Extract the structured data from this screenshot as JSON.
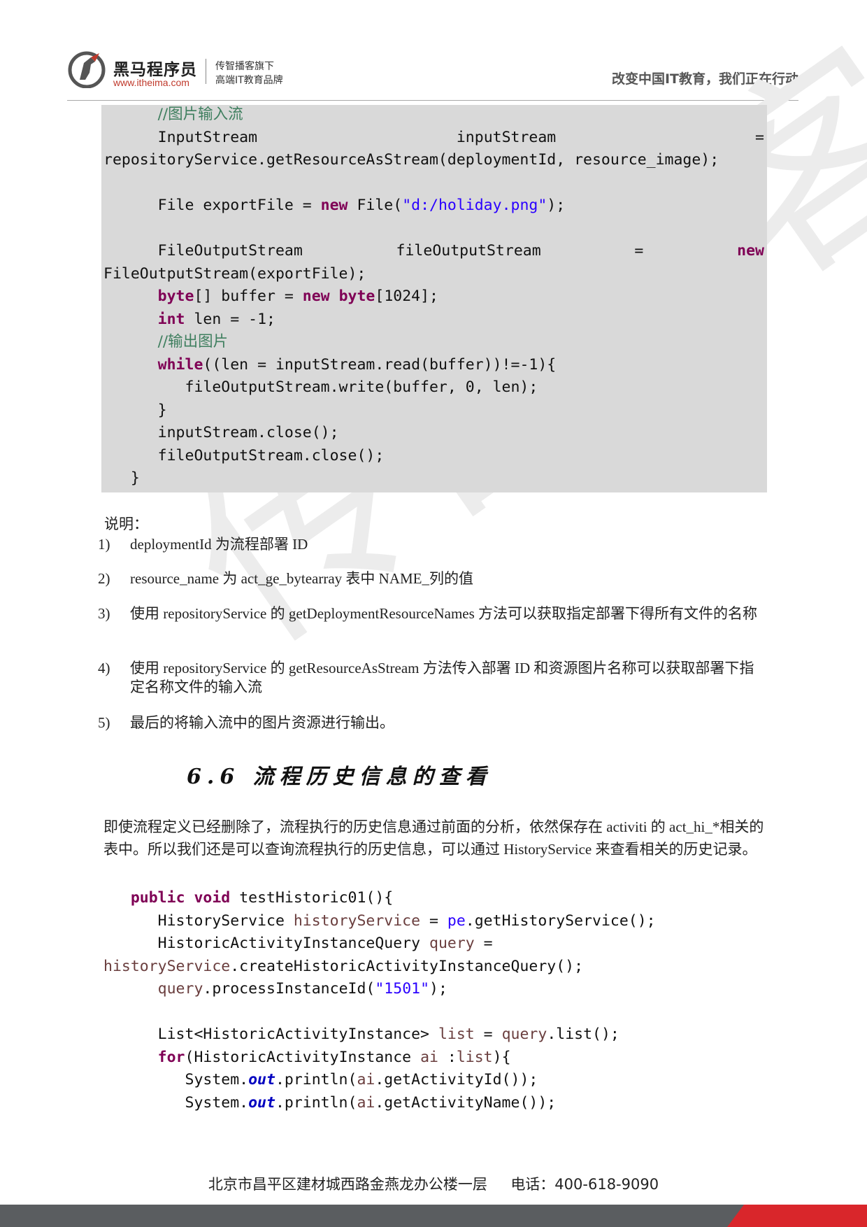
{
  "header": {
    "logo_cn": "黑马程序员",
    "logo_url": "www.itheima.com",
    "tagline_1": "传智播客旗下",
    "tagline_2": "高端IT教育品牌",
    "slogan": "改变中国IT教育，我们正在行动"
  },
  "watermark": "传智播客",
  "code1": {
    "l1": "//图片输入流",
    "l2a": "InputStream",
    "l2b": "inputStream",
    "l2c": "=",
    "l3": "repositoryService.getResourceAsStream(deploymentId, resource_image);",
    "l5a": "File exportFile = ",
    "l5b": "new",
    "l5c": " File(",
    "l5d": "\"d:/holiday.png\"",
    "l5e": ");",
    "l7a": "FileOutputStream",
    "l7b": "fileOutputStream",
    "l7c": "=",
    "l7d": "new",
    "l8": "FileOutputStream(exportFile);",
    "l9a": "byte",
    "l9b": "[] buffer = ",
    "l9c": "new",
    "l9d": " ",
    "l9e": "byte",
    "l9f": "[1024];",
    "l10a": "int",
    "l10b": " len = -1;",
    "l11": "//输出图片",
    "l12a": "while",
    "l12b": "((len = inputStream.read(buffer))!=-1){",
    "l13": "fileOutputStream.write(buffer, 0, len);",
    "l14": "}",
    "l15": "inputStream.close();",
    "l16": "fileOutputStream.close();",
    "l17": "}"
  },
  "notes": {
    "title": "说明：",
    "items": [
      {
        "num": "1)",
        "text": "deploymentId 为流程部署 ID"
      },
      {
        "num": "2)",
        "text": "resource_name 为 act_ge_bytearray 表中 NAME_列的值"
      },
      {
        "num": "3)",
        "text": "使用 repositoryService 的 getDeploymentResourceNames 方法可以获取指定部署下得所有文件的名称"
      },
      {
        "num": "4)",
        "text": "使用 repositoryService 的 getResourceAsStream 方法传入部署 ID 和资源图片名称可以获取部署下指定名称文件的输入流"
      },
      {
        "num": "5)",
        "text": "最后的将输入流中的图片资源进行输出。"
      }
    ]
  },
  "section": {
    "heading": "6.6 流程历史信息的查看",
    "intro": "即使流程定义已经删除了，流程执行的历史信息通过前面的分析，依然保存在 activiti 的 act_hi_*相关的表中。所以我们还是可以查询流程执行的历史信息，可以通过 HistoryService 来查看相关的历史记录。"
  },
  "code2": {
    "l1a": "public",
    "l1b": " ",
    "l1c": "void",
    "l1d": " testHistoric01(){",
    "l2a": "HistoryService ",
    "l2b": "historyService",
    "l2c": " = ",
    "l2d": "pe",
    "l2e": ".getHistoryService();",
    "l3a": "HistoricActivityInstanceQuery ",
    "l3b": "query",
    "l3c": " =",
    "l4a": "historyService",
    "l4b": ".createHistoricActivityInstanceQuery();",
    "l5a": "query",
    "l5b": ".processInstanceId(",
    "l5c": "\"1501\"",
    "l5d": ");",
    "l7a": "List<HistoricActivityInstance> ",
    "l7b": "list",
    "l7c": " = ",
    "l7d": "query",
    "l7e": ".list();",
    "l8a": "for",
    "l8b": "(HistoricActivityInstance ",
    "l8c": "ai",
    "l8d": " :",
    "l8e": "list",
    "l8f": "){",
    "l9a": "System.",
    "l9b": "out",
    "l9c": ".println(",
    "l9d": "ai",
    "l9e": ".getActivityId());",
    "l10a": "System.",
    "l10b": "out",
    "l10c": ".println(",
    "l10d": "ai",
    "l10e": ".getActivityName());"
  },
  "footer": {
    "address": "北京市昌平区建材城西路金燕龙办公楼一层",
    "phone": "电话：400-618-9090"
  }
}
